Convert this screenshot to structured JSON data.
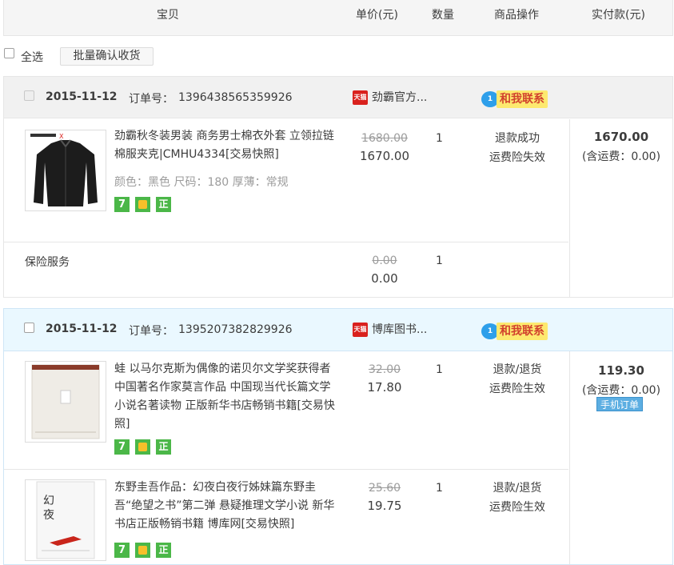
{
  "header": {
    "col_item": "宝贝",
    "col_price": "单价(元)",
    "col_qty": "数量",
    "col_ops": "商品操作",
    "col_paid": "实付款(元)"
  },
  "selectbar": {
    "select_all": "全选",
    "batch_confirm": "批量确认收货"
  },
  "orders": [
    {
      "date": "2015-11-12",
      "order_no_label": "订单号：",
      "order_no": "1396438565359926",
      "tmall_tag": "天猫",
      "shop_name": "劲霸官方...",
      "contact_label": "和我联系",
      "contact_count": "1",
      "items": [
        {
          "title": "劲霸秋冬装男装 商务男士棉衣外套 立领拉链棉服夹克|CMHU4334[交易快照]",
          "sku": "颜色：黑色  尺码：180  厚薄：常规",
          "orig_price": "1680.00",
          "price": "1670.00",
          "qty": "1",
          "op1": "退款成功",
          "op2": "运费险失效",
          "badges": [
            "7",
            "赔",
            "正"
          ]
        }
      ],
      "insurance": {
        "label": "保险服务",
        "orig_price": "0.00",
        "price": "0.00",
        "qty": "1"
      },
      "paid_total": "1670.00",
      "shipping": "(含运费：0.00)"
    },
    {
      "date": "2015-11-12",
      "order_no_label": "订单号：",
      "order_no": "1395207382829926",
      "tmall_tag": "天猫",
      "shop_name": "博库图书...",
      "contact_label": "和我联系",
      "contact_count": "1",
      "items": [
        {
          "title": "蛙 以马尔克斯为偶像的诺贝尔文学奖获得者 中国著名作家莫言作品 中国现当代长篇文学小说名著读物 正版新华书店畅销书籍[交易快照]",
          "orig_price": "32.00",
          "price": "17.80",
          "qty": "1",
          "op1": "退款/退货",
          "op2": "运费险生效",
          "badges": [
            "7",
            "赔",
            "正"
          ]
        },
        {
          "title": "东野圭吾作品：幻夜白夜行姊妹篇东野圭吾“绝望之书”第二弹 悬疑推理文学小说 新华书店正版畅销书籍 博库网[交易快照]",
          "orig_price": "25.60",
          "price": "19.75",
          "qty": "1",
          "op1": "退款/退货",
          "op2": "运费险生效",
          "badges": [
            "7",
            "赔",
            "正"
          ]
        }
      ],
      "paid_total": "119.30",
      "shipping": "(含运费：0.00)",
      "mobile_order": "手机订单"
    }
  ],
  "colors": {
    "tmall_red": "#d9211d",
    "contact_bg": "#fde96f",
    "contact_text": "#d1402d",
    "badge_green": "#4bb748",
    "order2_head_bg": "#eaf8ff",
    "mobile_btn": "#5caee2"
  }
}
